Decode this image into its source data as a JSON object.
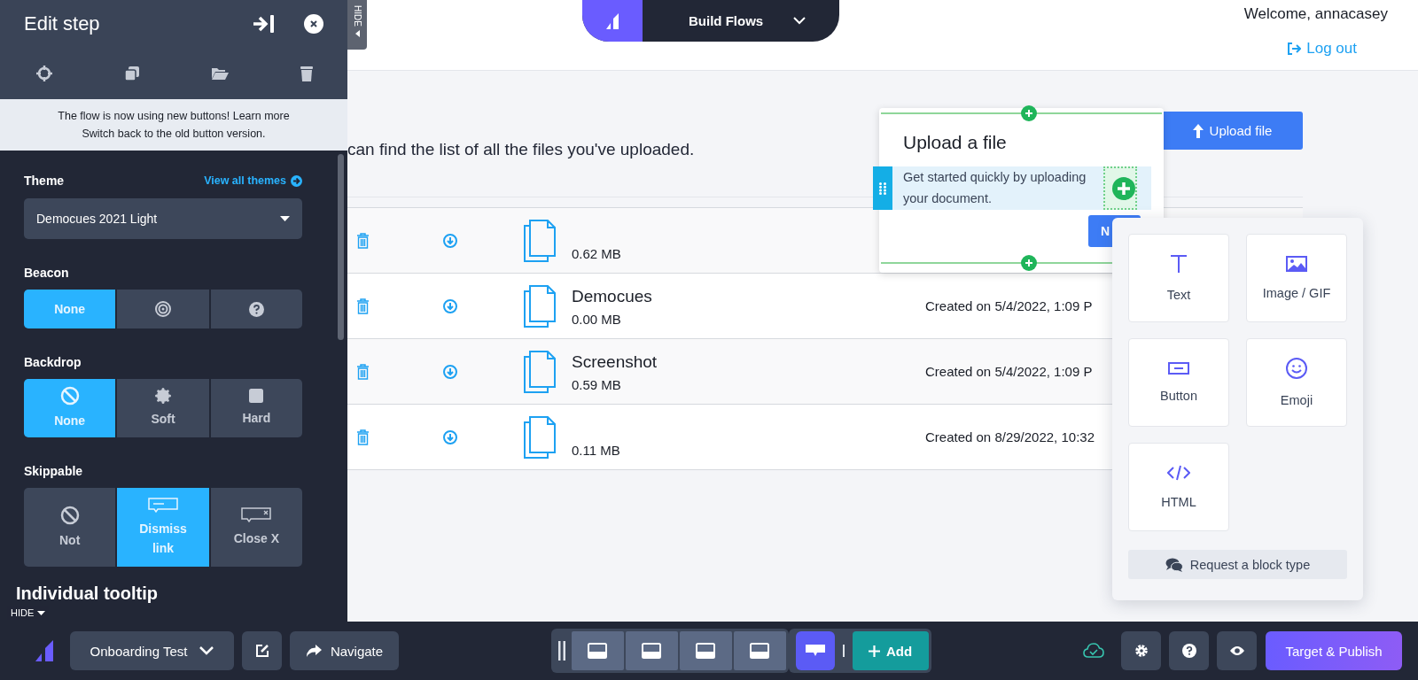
{
  "panel": {
    "title": "Edit step",
    "hide_tab": "HIDE",
    "notice": {
      "text_1": "The flow is now using new buttons!",
      "link_1": "Learn more",
      "link_2": "Switch back",
      "text_2": "to the old button version."
    },
    "theme": {
      "label": "Theme",
      "link": "View all themes",
      "value": "Democues 2021 Light"
    },
    "sections": [
      {
        "label": "Beacon",
        "options": [
          {
            "kind": "none",
            "label": "None",
            "selected": true
          },
          {
            "kind": "target",
            "selected": false
          },
          {
            "kind": "help",
            "selected": false
          }
        ]
      },
      {
        "label": "Backdrop",
        "options": [
          {
            "kind": "none",
            "label": "None",
            "selected": true
          },
          {
            "kind": "soft",
            "label": "Soft",
            "selected": false
          },
          {
            "kind": "hard",
            "label": "Hard",
            "selected": false
          }
        ]
      },
      {
        "label": "Skippable",
        "options": [
          {
            "kind": "none",
            "label": "Not",
            "selected": false
          },
          {
            "kind": "dismiss",
            "label": "Dismiss link",
            "selected": true
          },
          {
            "kind": "close",
            "label": "Close X",
            "selected": false
          }
        ]
      }
    ],
    "next_heading": "Individual tooltip",
    "bottom_hide": "HIDE"
  },
  "header": {
    "brand_menu": "Build Flows",
    "welcome": "Welcome, annacasey",
    "logout": "Log out"
  },
  "page": {
    "description": "can find the list of all the files you've uploaded.",
    "upload_button": "Upload file",
    "files": [
      {
        "size": "0.62 MB"
      },
      {
        "name": "Democues",
        "size": "0.00 MB",
        "created": "Created on 5/4/2022, 1:09 P"
      },
      {
        "name": "Screenshot",
        "size": "0.59 MB",
        "created": "Created on 5/4/2022, 1:09 P"
      },
      {
        "size": "0.11 MB",
        "created": "Created on 8/29/2022, 10:32"
      }
    ]
  },
  "tooltip": {
    "title": "Upload a file",
    "body": "Get started quickly by uploading your document.",
    "button": "N"
  },
  "block_menu": {
    "items": [
      {
        "kind": "text",
        "label": "Text"
      },
      {
        "kind": "image",
        "label": "Image / GIF"
      },
      {
        "kind": "button",
        "label": "Button"
      },
      {
        "kind": "emoji",
        "label": "Emoji"
      },
      {
        "kind": "html",
        "label": "HTML"
      }
    ],
    "request": "Request a block type"
  },
  "toolbar": {
    "flow": "Onboarding Test",
    "navigate": "Navigate",
    "step_types": [
      {
        "kind": "bottom",
        "selected": false
      },
      {
        "kind": "bottom",
        "selected": false
      },
      {
        "kind": "bottom",
        "selected": false
      },
      {
        "kind": "bottom",
        "selected": false
      },
      {
        "kind": "tooltip",
        "selected": true
      }
    ],
    "add": "Add",
    "publish": "Target & Publish"
  }
}
